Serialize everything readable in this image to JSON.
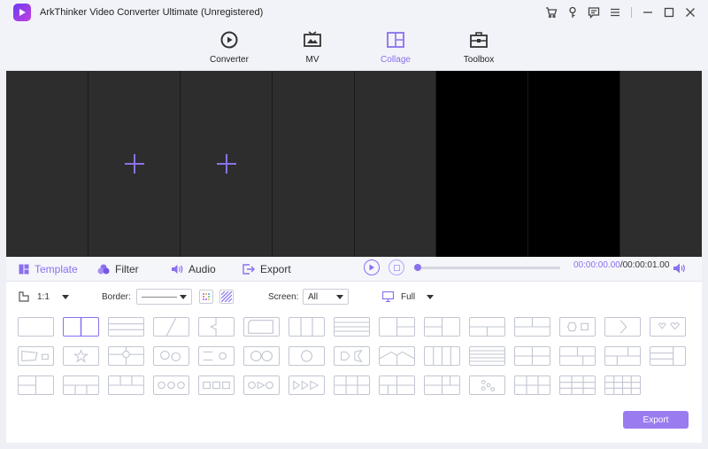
{
  "window": {
    "title": "ArkThinker Video Converter Ultimate (Unregistered)",
    "controls": [
      "cart-icon",
      "key-icon",
      "chat-icon",
      "menu-icon",
      "minimize-icon",
      "maximize-icon",
      "close-icon"
    ]
  },
  "nav": {
    "tabs": [
      {
        "label": "Converter",
        "icon": "converter-icon",
        "active": false
      },
      {
        "label": "MV",
        "icon": "tv-icon",
        "active": false
      },
      {
        "label": "Collage",
        "icon": "collage-icon",
        "active": true
      },
      {
        "label": "Toolbox",
        "icon": "toolbox-icon",
        "active": false
      }
    ]
  },
  "toolbar": {
    "tabs": [
      {
        "label": "Template",
        "icon": "template-icon",
        "active": true
      },
      {
        "label": "Filter",
        "icon": "filter-icon",
        "active": false
      },
      {
        "label": "Audio",
        "icon": "audio-icon",
        "active": false
      },
      {
        "label": "Export",
        "icon": "export-icon",
        "active": false
      }
    ],
    "time_current": "00:00:00.00",
    "time_total": "/00:00:01.00",
    "progress": 0
  },
  "options": {
    "ratio": "1:1",
    "border_label": "Border:",
    "screen_label": "Screen:",
    "screen_value": "All",
    "display_value": "Full"
  },
  "templates": {
    "selected_index": 1,
    "count": 43
  },
  "export_button": "Export",
  "colors": {
    "accent": "#8a6ff0",
    "preview_bg": "#2d2d2d",
    "preview_black": "#000000",
    "template_border": "#c2c6d2"
  }
}
